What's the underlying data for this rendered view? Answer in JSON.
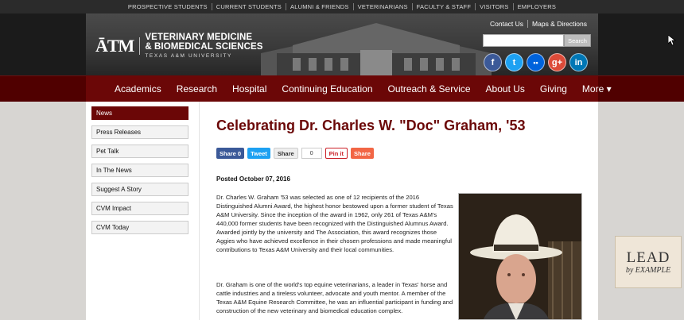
{
  "topbar": {
    "links": [
      "PROSPECTIVE STUDENTS",
      "CURRENT STUDENTS",
      "ALUMNI & FRIENDS",
      "VETERINARIANS",
      "FACULTY & STAFF",
      "VISITORS",
      "EMPLOYERS"
    ]
  },
  "header": {
    "logo_mark": "ĀTM",
    "logo_line1": "VETERINARY MEDICINE",
    "logo_line2": "& BIOMEDICAL SCIENCES",
    "logo_line3": "TEXAS A&M UNIVERSITY",
    "contact_label": "Contact Us",
    "maps_label": "Maps & Directions",
    "search_placeholder": "",
    "search_button": "Search",
    "social": [
      {
        "icon": "facebook-icon",
        "glyph": "f",
        "color": "#3b5998"
      },
      {
        "icon": "twitter-icon",
        "glyph": "t",
        "color": "#1da1f2"
      },
      {
        "icon": "flickr-icon",
        "glyph": "••",
        "color": "#0063dc"
      },
      {
        "icon": "google-plus-icon",
        "glyph": "g+",
        "color": "#dd4b39"
      },
      {
        "icon": "linkedin-icon",
        "glyph": "in",
        "color": "#0077b5"
      }
    ]
  },
  "nav": {
    "items": [
      "Academics",
      "Research",
      "Hospital",
      "Continuing Education",
      "Outreach & Service",
      "About Us",
      "Giving",
      "More ▾"
    ]
  },
  "sidebar": {
    "items": [
      "News",
      "Press Releases",
      "Pet Talk",
      "In The News",
      "Suggest A Story",
      "CVM Impact",
      "CVM Today"
    ],
    "active_index": 0
  },
  "article": {
    "title": "Celebrating Dr. Charles W. \"Doc\" Graham, '53",
    "share": {
      "facebook_label": "Share 0",
      "twitter_label": "Tweet",
      "linkedin_label": "Share",
      "linkedin_count": "0",
      "pinterest_label": "Pin it",
      "share_label": "Share"
    },
    "posted": "Posted October 07, 2016",
    "paragraph1": "Dr. Charles W. Graham '53 was selected as one of 12 recipients of the 2016 Distinguished Alumni Award, the highest honor bestowed upon a former student of Texas A&M University. Since the inception of the award in 1962, only 261 of Texas A&M's 440,000 former students have been recognized with the Distinguished Alumnus Award. Awarded jointly by the university and The Association, this award recognizes those Aggies who have achieved excellence in their chosen professions and made meaningful contributions to Texas A&M University and their local communities.",
    "paragraph2": "Dr. Graham is one of the world's top equine veterinarians, a leader in Texas' horse and cattle industries and a tireless volunteer, advocate and youth mentor. A member of the Texas A&M Equine Research Committee, he was an influential participant in funding and construction of the new veterinary and biomedical education complex."
  },
  "lead_badge": {
    "top": "LEAD",
    "bottom": "by EXAMPLE"
  }
}
